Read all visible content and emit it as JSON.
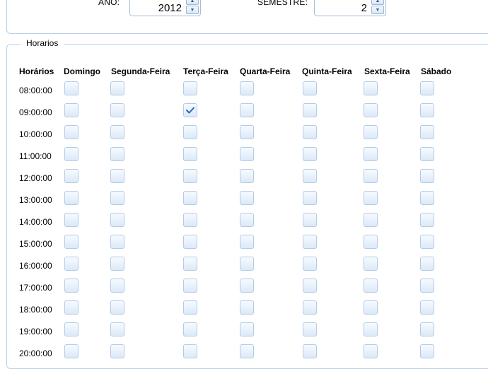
{
  "filters": {
    "ano_label": "ANO:",
    "ano_value": "2012",
    "semestre_label": "SEMESTRE:",
    "semestre_value": "2"
  },
  "schedule": {
    "legend": "Horarios",
    "time_header": "Horários",
    "days": [
      "Domingo",
      "Segunda-Feira",
      "Terça-Feira",
      "Quarta-Feira",
      "Quinta-Feira",
      "Sexta-Feira",
      "Sábado"
    ],
    "times": [
      "08:00:00",
      "09:00:00",
      "10:00:00",
      "11:00:00",
      "12:00:00",
      "13:00:00",
      "14:00:00",
      "15:00:00",
      "16:00:00",
      "17:00:00",
      "18:00:00",
      "19:00:00",
      "20:00:00"
    ],
    "checked": [
      {
        "time": "09:00:00",
        "day": "Terça-Feira"
      }
    ]
  }
}
